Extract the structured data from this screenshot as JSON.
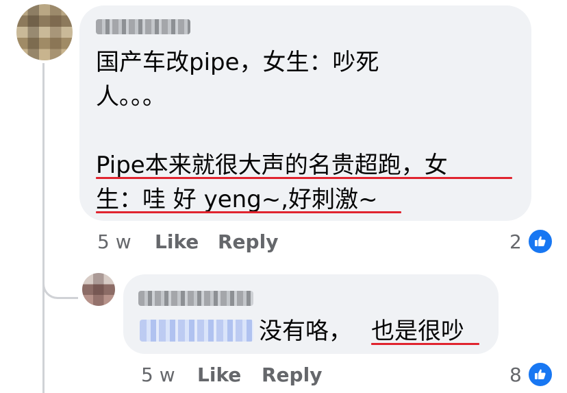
{
  "comment": {
    "line1": "国产车改pipe，女生：吵死",
    "line2": "人。。。",
    "line3": "Pipe本来就很大声的名贵超跑，女",
    "line4": "生：哇 好 yeng~,好刺激~",
    "time": "5 w",
    "like_label": "Like",
    "reply_label": "Reply",
    "reaction_count": "2"
  },
  "reply": {
    "text_a": "没有咯，",
    "text_b": "也是很吵",
    "time": "5 w",
    "like_label": "Like",
    "reply_label": "Reply",
    "reaction_count": "8"
  },
  "colors": {
    "bubble": "#f0f2f5",
    "meta_text": "#65676b",
    "like_blue": "#1877f2",
    "underline_red": "#e0242f"
  },
  "icons": {
    "reaction": "thumbs-up-icon"
  }
}
